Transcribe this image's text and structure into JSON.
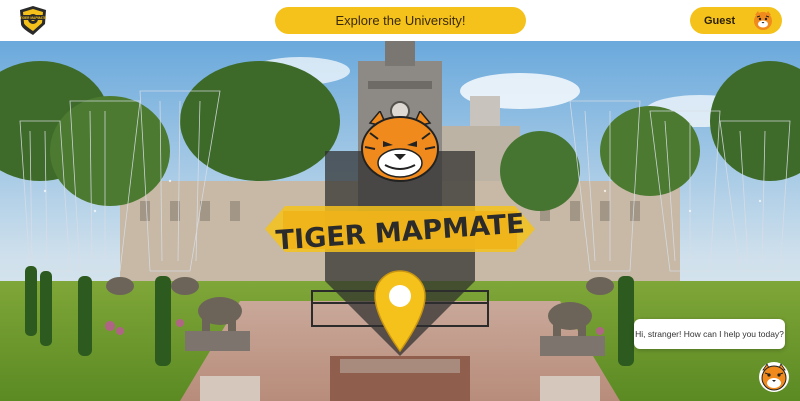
{
  "header": {
    "explore_label": "Explore the University!",
    "guest_label": "Guest",
    "logo_text": "TIGER MAPMATE"
  },
  "hero": {
    "emblem_title": "TIGER MAPMATE"
  },
  "chat": {
    "greeting": "Hi, stranger! How can I help you today?"
  },
  "colors": {
    "accent": "#f4c21b",
    "dark": "#2a2a2a"
  },
  "icons": [
    "tiger-logo-icon",
    "tiger-avatar-icon",
    "map-pin-icon",
    "tiger-chatbot-icon"
  ]
}
